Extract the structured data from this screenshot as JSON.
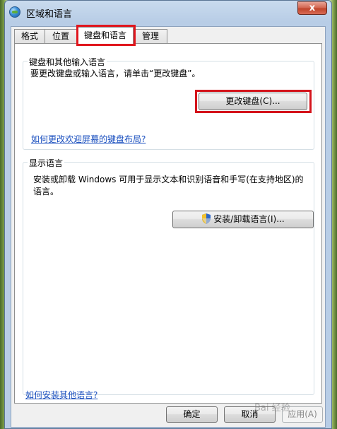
{
  "window": {
    "title": "区域和语言",
    "close_label": "x"
  },
  "tabs": [
    {
      "label": "格式",
      "active": false
    },
    {
      "label": "位置",
      "active": false
    },
    {
      "label": "键盘和语言",
      "active": true
    },
    {
      "label": "管理",
      "active": false
    }
  ],
  "keyboard_group": {
    "title": "键盘和其他输入语言",
    "description": "要更改键盘或输入语言，请单击“更改键盘”。",
    "change_button": "更改键盘(C)...",
    "layout_link": "如何更改欢迎屏幕的键盘布局?"
  },
  "display_group": {
    "title": "显示语言",
    "description": "安装或卸载 Windows 可用于显示文本和识别语音和手写(在支持地区)的语言。",
    "install_button": "安装/卸载语言(I)..."
  },
  "install_link": "如何安装其他语言?",
  "footer": {
    "ok": "确定",
    "cancel": "取消",
    "apply": "应用(A)"
  },
  "watermark": "Bai 经验"
}
